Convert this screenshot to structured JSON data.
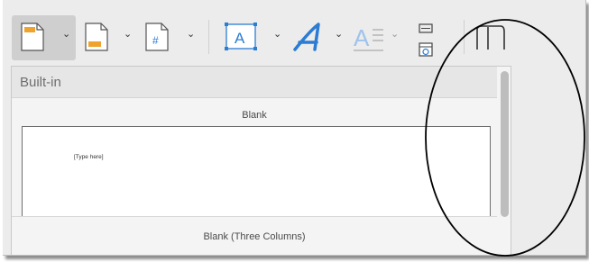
{
  "toolbar": {
    "buttons": [
      {
        "name": "cover-page-button",
        "icon": "document-header-icon"
      },
      {
        "name": "footer-button",
        "icon": "document-footer-icon"
      },
      {
        "name": "page-number-button",
        "icon": "page-number-icon",
        "glyph": "#"
      },
      {
        "name": "text-box-button",
        "icon": "text-box-icon",
        "glyph": "A"
      },
      {
        "name": "wordart-button",
        "icon": "wordart-icon",
        "glyph": "A"
      },
      {
        "name": "drop-cap-button",
        "icon": "drop-cap-icon",
        "glyph": "A"
      },
      {
        "name": "date-time-button",
        "icon": "date-time-icon"
      },
      {
        "name": "equation-button",
        "icon": "equation-icon",
        "glyph": "π"
      }
    ],
    "chevron": "⌄",
    "accent": "#2b7cd3",
    "orange": "#f0a22e"
  },
  "gallery": {
    "section_label": "Built-in",
    "items": [
      {
        "title": "Blank",
        "preview_text": "[Type here]"
      },
      {
        "title": "Blank (Three Columns)"
      }
    ]
  }
}
